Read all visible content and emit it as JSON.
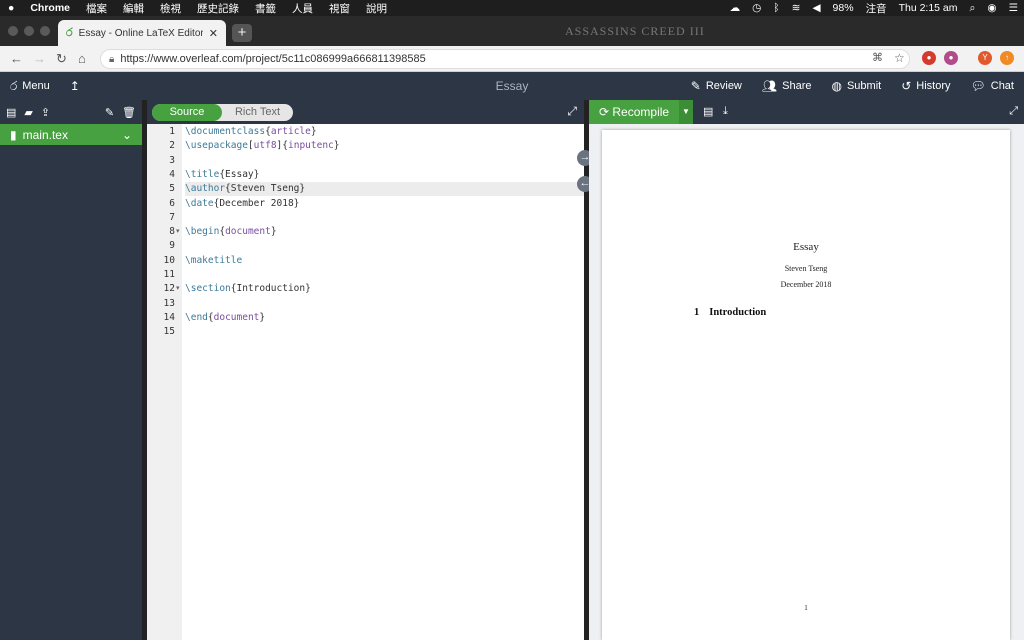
{
  "menubar": {
    "app": "Chrome",
    "menus": [
      "檔案",
      "編輯",
      "檢視",
      "歷史記錄",
      "書籤",
      "人員",
      "視窗",
      "說明"
    ],
    "battery": "98%",
    "input_method": "注音",
    "clock": "Thu 2:15 am"
  },
  "browser": {
    "tab_title": "Essay - Online LaTeX Editor Ov",
    "url": "https://www.overleaf.com/project/5c11c086999a666811398585",
    "bg_logo": "ASSASSINS CREED III"
  },
  "overleaf": {
    "menu_label": "Menu",
    "project_title": "Essay",
    "review_label": "Review",
    "share_label": "Share",
    "submit_label": "Submit",
    "history_label": "History",
    "chat_label": "Chat",
    "accent": "#47a141"
  },
  "filetree": {
    "files": [
      "main.tex"
    ]
  },
  "editor": {
    "source_label": "Source",
    "rich_label": "Rich Text",
    "lines": [
      {
        "n": "1",
        "cmd": "\\documentclass",
        "arg": "article",
        "rest": "",
        "fold": ""
      },
      {
        "n": "2",
        "cmd": "\\usepackage",
        "arg": "inputenc",
        "opt": "utf8",
        "rest": "",
        "fold": ""
      },
      {
        "n": "3",
        "cmd": "",
        "arg": "",
        "rest": "",
        "fold": ""
      },
      {
        "n": "4",
        "cmd": "\\title",
        "arg": "",
        "rest": "{Essay}",
        "fold": ""
      },
      {
        "n": "5",
        "cmd": "\\author",
        "arg": "",
        "rest": "{Steven Tseng}",
        "fold": ""
      },
      {
        "n": "6",
        "cmd": "\\date",
        "arg": "",
        "rest": "{December 2018}",
        "fold": ""
      },
      {
        "n": "7",
        "cmd": "",
        "arg": "",
        "rest": "",
        "fold": ""
      },
      {
        "n": "8",
        "cmd": "\\begin",
        "arg": "document",
        "rest": "",
        "fold": "▾"
      },
      {
        "n": "9",
        "cmd": "",
        "arg": "",
        "rest": "",
        "fold": ""
      },
      {
        "n": "10",
        "cmd": "\\maketitle",
        "arg": "",
        "rest": "",
        "fold": ""
      },
      {
        "n": "11",
        "cmd": "",
        "arg": "",
        "rest": "",
        "fold": ""
      },
      {
        "n": "12",
        "cmd": "\\section",
        "arg": "",
        "rest": "{Introduction}",
        "fold": "▾"
      },
      {
        "n": "13",
        "cmd": "",
        "arg": "",
        "rest": "",
        "fold": ""
      },
      {
        "n": "14",
        "cmd": "\\end",
        "arg": "document",
        "rest": "",
        "fold": ""
      },
      {
        "n": "15",
        "cmd": "",
        "arg": "",
        "rest": "",
        "fold": ""
      }
    ]
  },
  "pdf": {
    "recompile_label": "Recompile",
    "title": "Essay",
    "author": "Steven Tseng",
    "date": "December 2018",
    "section_number": "1",
    "section_title": "Introduction",
    "page_number": "1"
  }
}
